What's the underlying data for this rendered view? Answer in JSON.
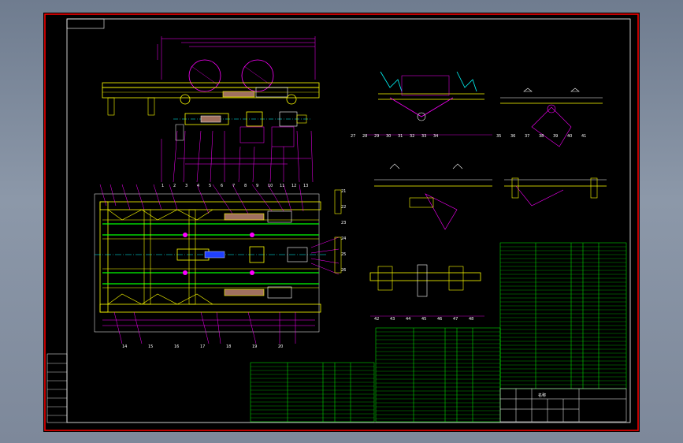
{
  "colors": {
    "background_top": "#6f7c8f",
    "sheet": "#000000",
    "border": "#ff0000",
    "frame": "#ffffff",
    "outline": "#ffff00",
    "leader": "#ff00ff",
    "bom_line": "#00ff00",
    "centerline": "#00ffff",
    "fill_dark": "#a07060"
  },
  "annotations": {
    "title_label": "名称",
    "leader_numbers": [
      "1",
      "2",
      "3",
      "4",
      "5",
      "6",
      "7",
      "8",
      "9",
      "10",
      "11",
      "12",
      "13",
      "14",
      "15",
      "16",
      "17",
      "18",
      "19",
      "20",
      "21",
      "22",
      "23",
      "24",
      "25",
      "26",
      "27",
      "28",
      "29",
      "30",
      "31",
      "32",
      "33",
      "34",
      "35",
      "36",
      "37",
      "38",
      "39",
      "40",
      "41",
      "42",
      "43",
      "44",
      "45",
      "46",
      "47",
      "48"
    ]
  }
}
